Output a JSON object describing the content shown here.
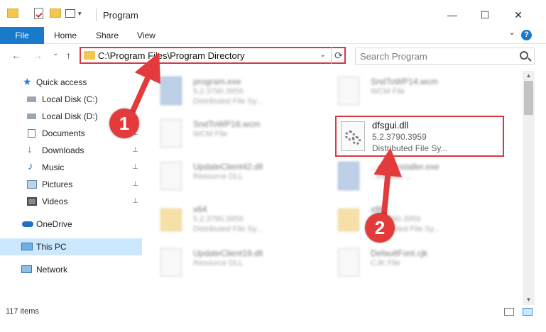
{
  "window": {
    "title": "Program",
    "minimize_glyph": "—",
    "maximize_glyph": "☐",
    "close_glyph": "✕"
  },
  "ribbon": {
    "tabs": [
      "File",
      "Home",
      "Share",
      "View"
    ],
    "help_glyph": "?",
    "expand_glyph": "⌄"
  },
  "navigation": {
    "back_glyph": "←",
    "forward_glyph": "→",
    "recent_glyph": "⌄",
    "up_glyph": "↑",
    "address": "C:\\Program Files\\Program Directory",
    "address_dropdown_glyph": "⌄",
    "refresh_glyph": "⟳",
    "search_placeholder": "Search Program"
  },
  "sidebar": {
    "items": [
      {
        "label": "Quick access",
        "icon": "star-icon",
        "pinned": false
      },
      {
        "label": "Local Disk (C:)",
        "icon": "drive-icon",
        "pinned": false
      },
      {
        "label": "Local Disk (D:)",
        "icon": "drive-icon",
        "pinned": false
      },
      {
        "label": "Documents",
        "icon": "documents-icon",
        "pinned": true
      },
      {
        "label": "Downloads",
        "icon": "download-icon",
        "pinned": true
      },
      {
        "label": "Music",
        "icon": "music-icon",
        "pinned": true
      },
      {
        "label": "Pictures",
        "icon": "pictures-icon",
        "pinned": true
      },
      {
        "label": "Videos",
        "icon": "videos-icon",
        "pinned": true
      },
      {
        "label": "OneDrive",
        "icon": "cloud-icon",
        "pinned": false
      },
      {
        "label": "This PC",
        "icon": "computer-icon",
        "pinned": false,
        "selected": true
      },
      {
        "label": "Network",
        "icon": "network-icon",
        "pinned": false
      }
    ],
    "pin_glyph": "📌"
  },
  "files": [
    {
      "name": "program.exe",
      "line1": "5.2.3790.3959",
      "line2": "Distributed File Sy...",
      "kind": "exe"
    },
    {
      "name": "SndToWP14.wcm",
      "line1": "WCM File",
      "line2": "",
      "kind": "file"
    },
    {
      "name": "SndToWP16.wcm",
      "line1": "WCM File",
      "line2": "",
      "kind": "file"
    },
    {
      "name": "UpdateClient42.dll",
      "line1": "Resource DLL",
      "line2": "",
      "kind": "file"
    },
    {
      "name": "...emsInstaller.exe",
      "line1": "...ineader ...",
      "line2": "",
      "kind": "exe"
    },
    {
      "name": "x64",
      "line1": "5.2.3790.3959",
      "line2": "Distributed File Sy...",
      "kind": "folder"
    },
    {
      "name": "x86",
      "line1": "5.2.3790.3959",
      "line2": "Distributed File Sy...",
      "kind": "folder"
    },
    {
      "name": "UpdateClient19.dll",
      "line1": "Resource DLL",
      "line2": "",
      "kind": "file"
    },
    {
      "name": "DefaultFont.cjk",
      "line1": "CJK File",
      "line2": "",
      "kind": "file"
    }
  ],
  "highlighted_file": {
    "name": "dfsgui.dll",
    "version": "5.2.3790.3959",
    "type": "Distributed File Sy..."
  },
  "status": {
    "item_count": "117 items"
  },
  "annotations": {
    "step1": "1",
    "step2": "2",
    "color": "#e33b3b"
  },
  "colors": {
    "accent": "#1979ca",
    "highlight_border": "#d9383f",
    "selection": "#cce8ff"
  }
}
